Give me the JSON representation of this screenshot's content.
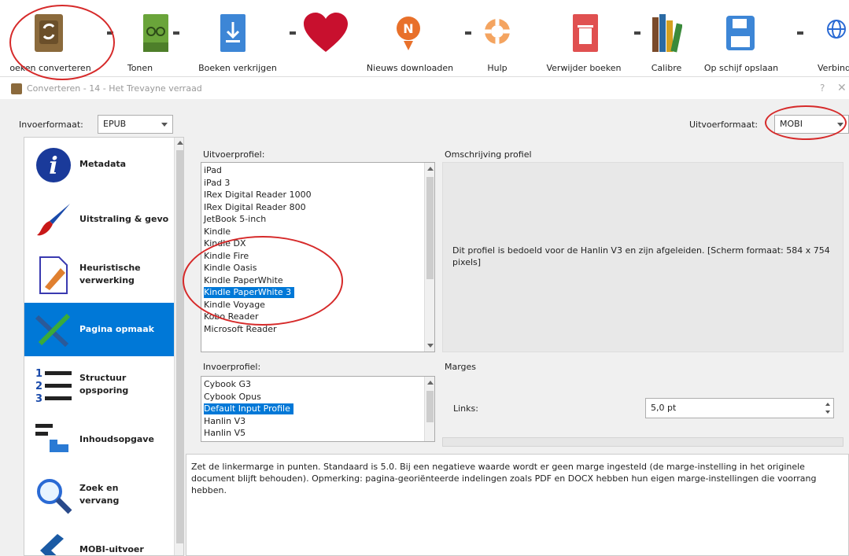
{
  "toolbar": {
    "items": [
      {
        "label": "oeken converteren",
        "icon": "convert-books-icon"
      },
      {
        "label": "Tonen",
        "icon": "view-icon"
      },
      {
        "label": "Boeken verkrijgen",
        "icon": "get-books-icon"
      },
      {
        "label": "",
        "icon": "donate-heart-icon"
      },
      {
        "label": "Nieuws downloaden",
        "icon": "news-icon"
      },
      {
        "label": "Hulp",
        "icon": "help-lifebuoy-icon"
      },
      {
        "label": "Verwijder boeken",
        "icon": "remove-books-icon"
      },
      {
        "label": "Calibre",
        "icon": "library-icon"
      },
      {
        "label": "Op schijf opslaan",
        "icon": "save-disk-icon"
      },
      {
        "label": "Verbind",
        "icon": "connect-globe-icon"
      }
    ]
  },
  "dialog": {
    "title": "Converteren - 14 - Het Trevayne verraad",
    "help": "?",
    "close": "✕"
  },
  "input_format": {
    "label": "Invoerformaat:",
    "value": "EPUB"
  },
  "output_format": {
    "label": "Uitvoerformaat:",
    "value": "MOBI"
  },
  "sidebar": {
    "items": [
      {
        "label": "Metadata",
        "icon": "info-icon"
      },
      {
        "label": "Uitstraling & gevo",
        "icon": "paintbrush-icon"
      },
      {
        "label": "Heuristische verwerking",
        "icon": "document-pen-icon"
      },
      {
        "label": "Pagina opmaak",
        "icon": "page-setup-tools-icon"
      },
      {
        "label": "Structuur opsporing",
        "icon": "numbered-list-icon"
      },
      {
        "label": "Inhoudsopgave",
        "icon": "toc-icon"
      },
      {
        "label": "Zoek en vervang",
        "icon": "magnifier-icon"
      },
      {
        "label": "MOBI-uitvoer",
        "icon": "mobi-chevron-icon"
      }
    ],
    "selected_index": 3
  },
  "output_profile": {
    "label": "Uitvoerprofiel:",
    "items": [
      "iPad",
      "iPad 3",
      "IRex Digital Reader 1000",
      "IRex Digital Reader 800",
      "JetBook 5-inch",
      "Kindle",
      "Kindle DX",
      "Kindle Fire",
      "Kindle Oasis",
      "Kindle PaperWhite",
      "Kindle PaperWhite 3",
      "Kindle Voyage",
      "Kobo Reader",
      "Microsoft Reader"
    ],
    "selected": "Kindle PaperWhite 3"
  },
  "profile_description": {
    "label": "Omschrijving profiel",
    "text": "Dit profiel is bedoeld voor de Hanlin V3 en zijn afgeleiden. [Scherm formaat: 584 x 754 pixels]"
  },
  "input_profile": {
    "label": "Invoerprofiel:",
    "items": [
      "Cybook G3",
      "Cybook Opus",
      "Default Input Profile",
      "Hanlin V3",
      "Hanlin V5"
    ],
    "selected": "Default Input Profile"
  },
  "margins": {
    "label": "Marges",
    "left_label": "Links:",
    "left_value": "5,0 pt"
  },
  "help_text": "Zet de linkermarge in punten. Standaard is 5.0. Bij een negatieve waarde wordt er geen marge ingesteld (de marge-instelling in het originele document blijft behouden). Opmerking: pagina-georiënteerde indelingen zoals PDF en DOCX hebben hun eigen marge-instellingen die voorrang hebben.",
  "colors": {
    "accent": "#0078d7",
    "annotation": "#d62a2a"
  }
}
